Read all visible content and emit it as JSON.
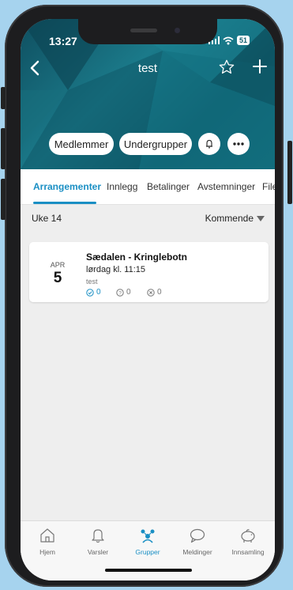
{
  "status": {
    "time": "13:27",
    "battery": "51"
  },
  "nav": {
    "title": "test"
  },
  "header_buttons": {
    "members": "Medlemmer",
    "subgroups": "Undergrupper"
  },
  "tabs": [
    {
      "label": "Arrangementer",
      "active": true
    },
    {
      "label": "Innlegg"
    },
    {
      "label": "Betalinger"
    },
    {
      "label": "Avstemninger"
    },
    {
      "label": "File"
    }
  ],
  "week": {
    "label": "Uke 14"
  },
  "filter": {
    "label": "Kommende"
  },
  "event": {
    "month": "APR",
    "day": "5",
    "title": "Sædalen - Kringlebotn",
    "time": "lørdag kl. 11:15",
    "group": "test",
    "rsvp": {
      "attending": "0",
      "maybe": "0",
      "declined": "0"
    }
  },
  "bottom_nav": [
    {
      "label": "Hjem",
      "icon": "home-icon"
    },
    {
      "label": "Varsler",
      "icon": "bell-icon"
    },
    {
      "label": "Grupper",
      "icon": "groups-icon",
      "active": true
    },
    {
      "label": "Meldinger",
      "icon": "chat-icon"
    },
    {
      "label": "Innsamling",
      "icon": "piggy-bank-icon"
    }
  ],
  "colors": {
    "accent": "#1a8fc4",
    "header": "#126c7b",
    "background": "#a6d3ee"
  }
}
